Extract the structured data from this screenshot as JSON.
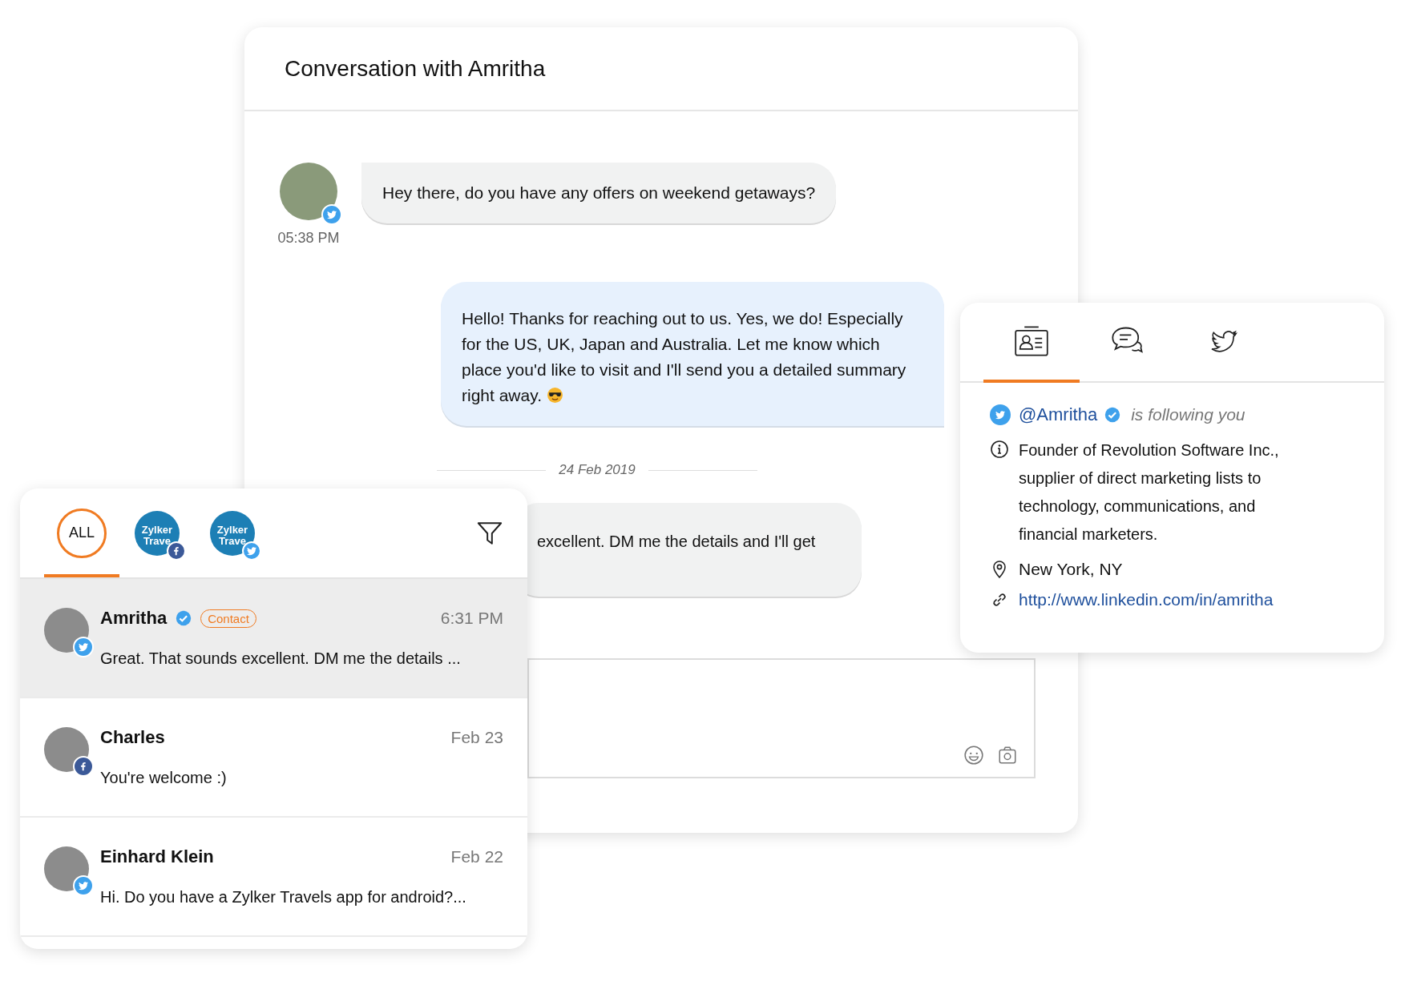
{
  "conversation": {
    "title": "Conversation with Amritha",
    "messages": [
      {
        "kind": "incoming",
        "text": "Hey there, do you have any offers on weekend getaways?",
        "time": "05:38 PM",
        "network": {
          "kind": "twitter"
        }
      },
      {
        "kind": "outgoing",
        "text": "Hello! Thanks for reaching out to us. Yes, we do! Especially for the US, UK, Japan and Australia. Let me know which place you'd like to visit and I'll send you a detailed summary right away.",
        "emoji": true
      },
      {
        "kind": "divider",
        "text": "24 Feb 2019"
      },
      {
        "kind": "incoming-partial",
        "text": "excellent. DM me the details and I'll get"
      }
    ]
  },
  "inbox": {
    "channels": [
      {
        "kind": "all",
        "label": "ALL",
        "selected": true
      },
      {
        "kind": "brand",
        "logo_lines": [
          "Zylker",
          "Trave"
        ],
        "network": {
          "kind": "facebook"
        },
        "selected": false
      },
      {
        "kind": "brand",
        "logo_lines": [
          "Zylker",
          "Trave"
        ],
        "network": {
          "kind": "twitter"
        },
        "selected": false
      }
    ],
    "threads": [
      {
        "name": "Amritha",
        "verified": true,
        "badge": "Contact",
        "time": "6:31 PM",
        "preview": "Great. That sounds excellent. DM me the details ...",
        "network": {
          "kind": "twitter"
        },
        "selected": true
      },
      {
        "name": "Charles",
        "verified": false,
        "time": "Feb 23",
        "preview": "You're welcome :)",
        "network": {
          "kind": "facebook"
        },
        "selected": false
      },
      {
        "name": "Einhard Klein",
        "verified": false,
        "time": "Feb 22",
        "preview": "Hi. Do you have a Zylker Travels app for android?...",
        "network": {
          "kind": "twitter"
        },
        "selected": false
      }
    ]
  },
  "profile": {
    "tabs": [
      {
        "kind": "contact",
        "selected": true
      },
      {
        "kind": "chat",
        "selected": false
      },
      {
        "kind": "twitter",
        "selected": false
      }
    ],
    "handle": "@Amritha",
    "verified": true,
    "following": "is following you",
    "bio": "Founder of Revolution Software Inc., supplier of direct marketing lists to technology, communications, and financial marketers.",
    "location": "New York, NY",
    "link": "http://www.linkedin.com/in/amritha"
  }
}
